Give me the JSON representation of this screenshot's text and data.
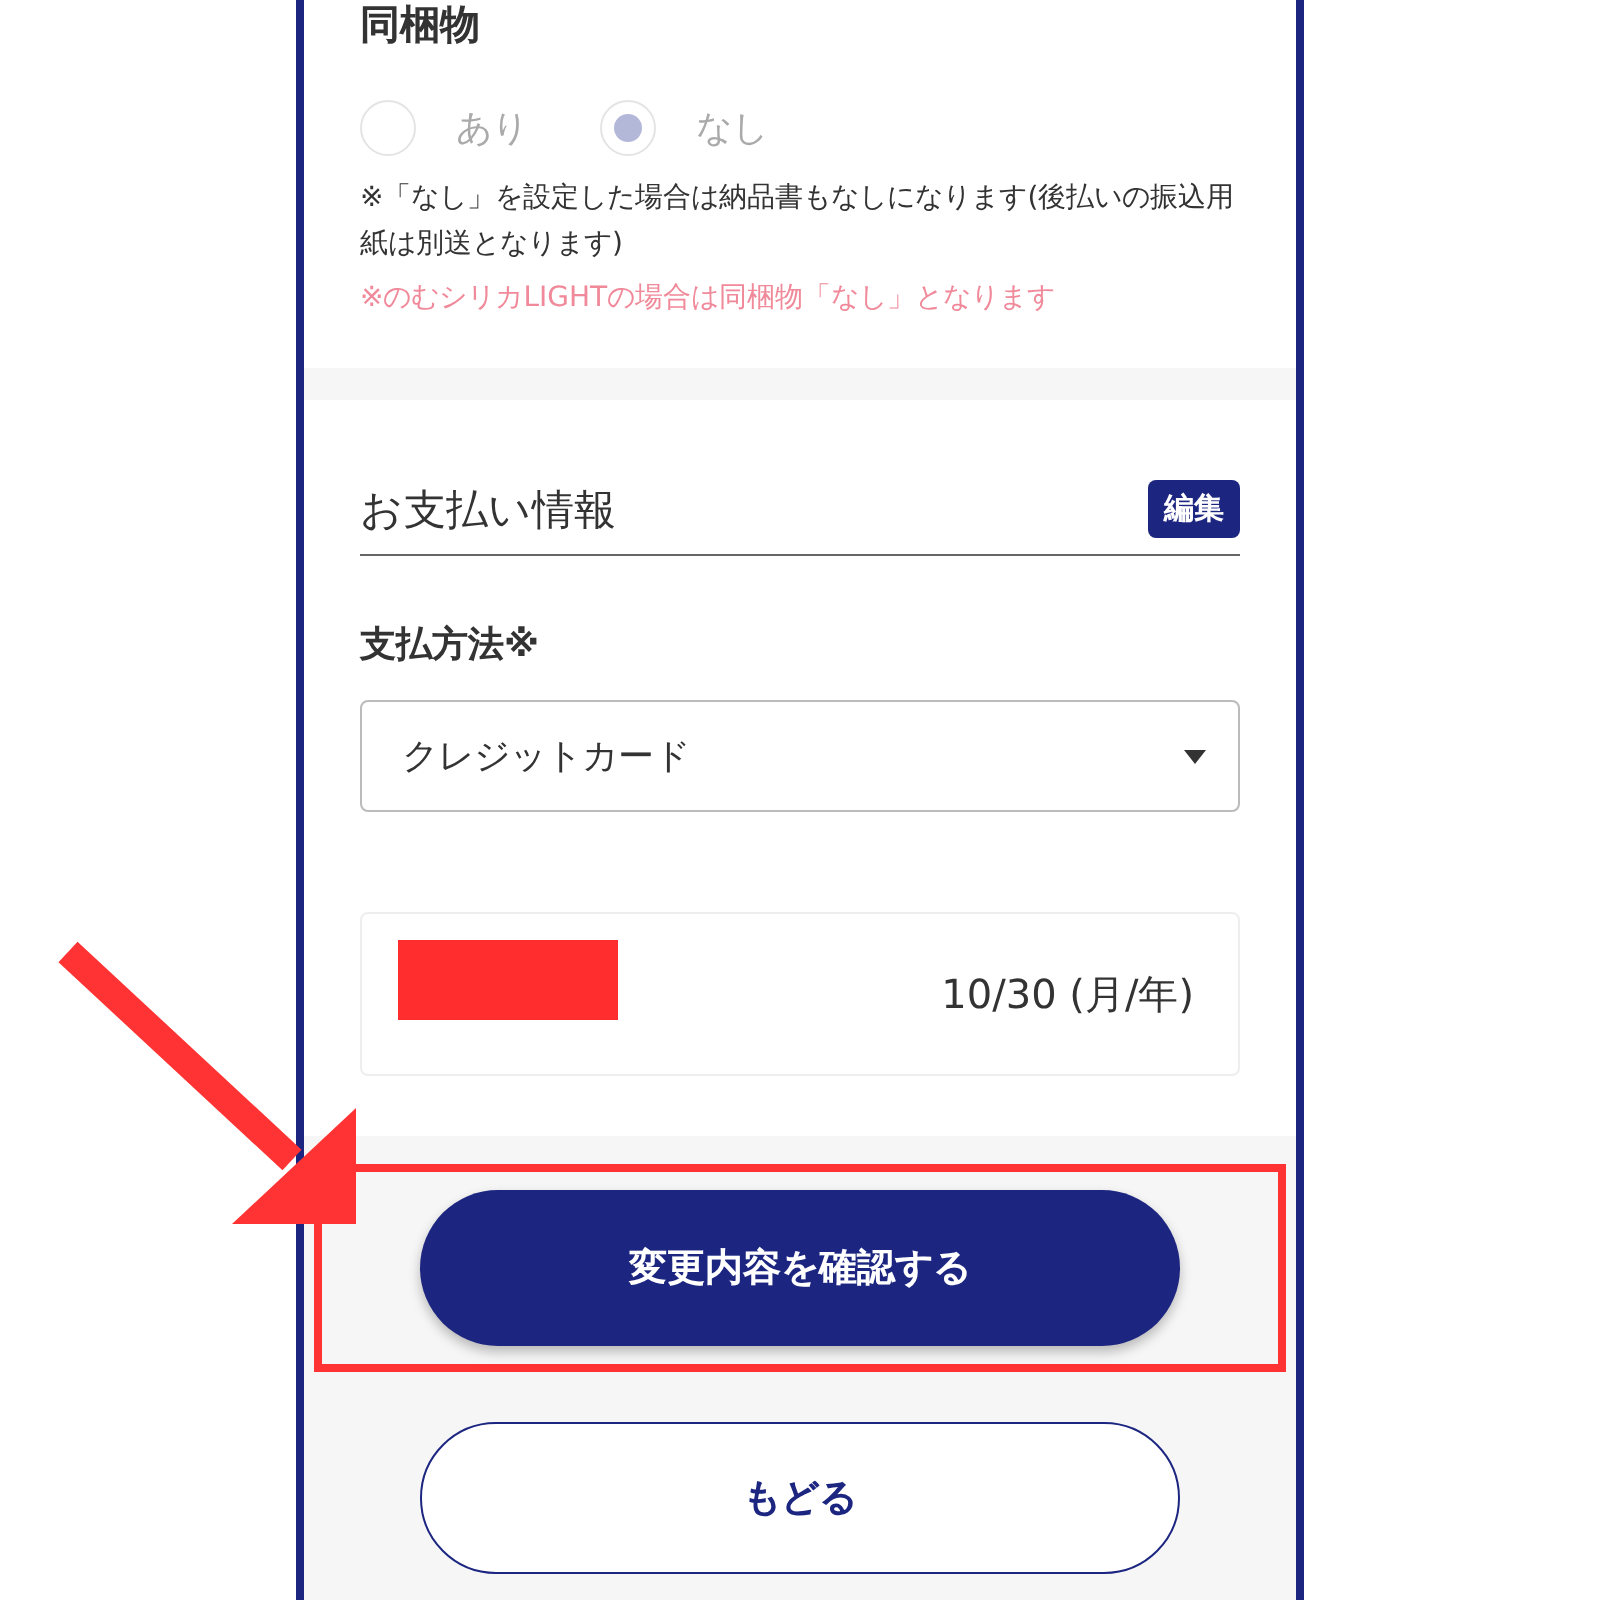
{
  "bundle": {
    "title": "同梱物",
    "disabled": true,
    "options": [
      {
        "label": "あり",
        "selected": false
      },
      {
        "label": "なし",
        "selected": true
      }
    ],
    "note": "※「なし」を設定した場合は納品書もなしになります(後払いの振込用紙は別送となります)",
    "warning": "※のむシリカLIGHTの場合は同梱物「なし」となります"
  },
  "payment": {
    "title": "お支払い情報",
    "edit_button": "編集",
    "method_label": "支払方法※",
    "method_value": "クレジットカード",
    "card": {
      "redacted": true,
      "expiry": "10/30 (月/年)"
    }
  },
  "buttons": [
    {
      "label": "変更内容を確認する",
      "kind": "primary",
      "highlighted": true
    },
    {
      "label": "もどる",
      "kind": "secondary",
      "highlighted": false
    }
  ]
}
